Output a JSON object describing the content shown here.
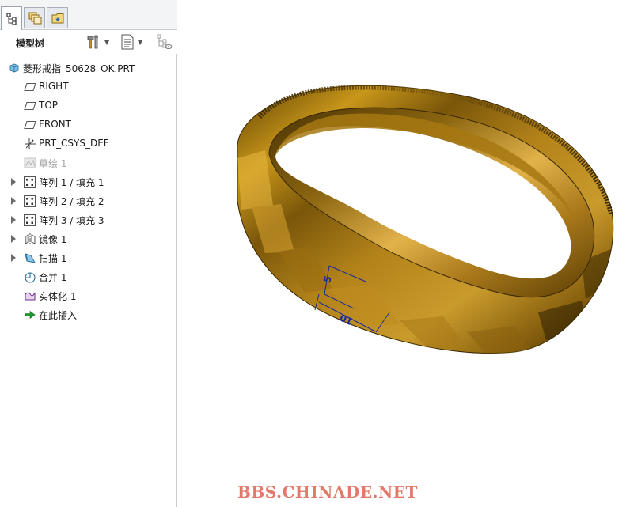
{
  "panel": {
    "tabs": [
      {
        "name": "model-tree-tab",
        "active": true
      },
      {
        "name": "layers-tab",
        "active": false
      },
      {
        "name": "favorites-tab",
        "active": false
      }
    ],
    "title": "模型树"
  },
  "toolbar": {
    "tools_icon": "hammer-wrench-icon",
    "settings_icon": "tree-settings-icon",
    "filter_icon": "tree-filter-icon"
  },
  "tree": {
    "root": {
      "label": "菱形戒指_50628_OK.PRT",
      "icon": "part-cube-icon"
    },
    "items": [
      {
        "label": "RIGHT",
        "icon": "datum-plane-icon",
        "expandable": false,
        "disabled": false
      },
      {
        "label": "TOP",
        "icon": "datum-plane-icon",
        "expandable": false,
        "disabled": false
      },
      {
        "label": "FRONT",
        "icon": "datum-plane-icon",
        "expandable": false,
        "disabled": false
      },
      {
        "label": "PRT_CSYS_DEF",
        "icon": "csys-icon",
        "expandable": false,
        "disabled": false
      },
      {
        "label": "草绘 1",
        "icon": "sketch-icon",
        "expandable": false,
        "disabled": true
      },
      {
        "label": "阵列 1 / 填充 1",
        "icon": "pattern-icon",
        "expandable": true,
        "disabled": false
      },
      {
        "label": "阵列 2 / 填充 2",
        "icon": "pattern-icon",
        "expandable": true,
        "disabled": false
      },
      {
        "label": "阵列 3 / 填充 3",
        "icon": "pattern-icon",
        "expandable": true,
        "disabled": false
      },
      {
        "label": "镜像 1",
        "icon": "mirror-icon",
        "expandable": true,
        "disabled": false
      },
      {
        "label": "扫描 1",
        "icon": "sweep-icon",
        "expandable": true,
        "disabled": false
      },
      {
        "label": "合并 1",
        "icon": "merge-icon",
        "expandable": false,
        "disabled": false
      },
      {
        "label": "实体化 1",
        "icon": "solidify-icon",
        "expandable": false,
        "disabled": false
      },
      {
        "label": "在此插入",
        "icon": "insert-here-arrow-icon",
        "expandable": false,
        "disabled": false
      }
    ]
  },
  "viewport": {
    "dimensions": [
      {
        "name": "dim-width",
        "text": "5"
      },
      {
        "name": "dim-height",
        "text": "10"
      }
    ],
    "dimension_color": "#1b2a9a",
    "ring_color": "#a8780f"
  },
  "watermark": "BBS.CHINADE.NET"
}
